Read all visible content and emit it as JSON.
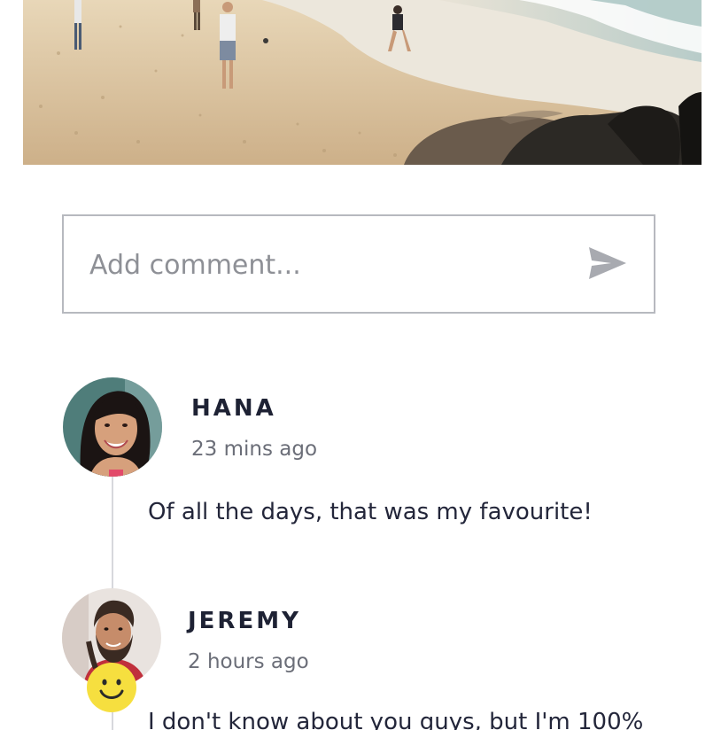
{
  "comment_form": {
    "placeholder": "Add comment..."
  },
  "comments": [
    {
      "author": "HANA",
      "time": "23 mins ago",
      "text": "Of all the days, that was my favourite!"
    },
    {
      "author": "JEREMY",
      "time": "2 hours ago",
      "text": "I don't know about you guys, but I'm 100%",
      "reaction": "smiley-emoji-icon"
    }
  ],
  "colors": {
    "border": "#b7b9bf",
    "send_icon": "#a8aab0",
    "author": "#1e2234",
    "timestamp": "#6b6e78",
    "thread_line": "#d7d8dc",
    "emoji": "#f6df3f"
  }
}
